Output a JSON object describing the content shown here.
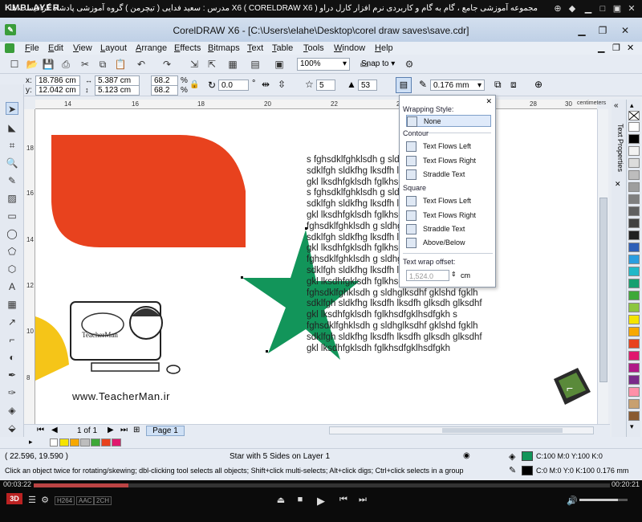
{
  "player": {
    "logo": "KMPLAYER",
    "title": "مجموعه آموزشی جامع ، گام به گام و کاربردی نرم افزار کارل دراو X6 ( CORELDRAW X6 ) مدرس : سعید فدایی ( تیچرمن ) گروه آموزشی پادشاه گرافیست ها",
    "time_elapsed": "00:03:22",
    "time_total": "00:20:21",
    "progress": 0.165,
    "codec_badges": [
      "H264",
      "AAC",
      "2CH"
    ]
  },
  "window": {
    "title": "CorelDRAW X6 - [C:\\Users\\elahe\\Desktop\\corel draw saves\\save.cdr]"
  },
  "menu": [
    "File",
    "Edit",
    "View",
    "Layout",
    "Arrange",
    "Effects",
    "Bitmaps",
    "Text",
    "Table",
    "Tools",
    "Window",
    "Help"
  ],
  "toolbar": {
    "zoom": "100%",
    "snap_to": "Snap to"
  },
  "property_bar": {
    "x": "18.786 cm",
    "y": "12.042 cm",
    "w": "5.387 cm",
    "h": "5.123 cm",
    "scale_w": "68.2",
    "scale_h": "68.2",
    "pct": "%",
    "angle": "0.0",
    "points": "5",
    "sharpness": "53",
    "outline_width": "0.176 mm"
  },
  "ruler": {
    "top_labels": [
      "14",
      "16",
      "18",
      "20",
      "22",
      "24",
      "26",
      "28",
      "30"
    ],
    "left_labels": [
      "18",
      "16",
      "14",
      "12",
      "10",
      "8"
    ],
    "unit": "centimeters"
  },
  "wrap_popup": {
    "wrapping_style": "Wrapping Style:",
    "none": "None",
    "contour_header": "Contour",
    "contour_left": "Text Flows Left",
    "contour_right": "Text Flows Right",
    "contour_straddle": "Straddle Text",
    "square_header": "Square",
    "square_left": "Text Flows Left",
    "square_right": "Text Flows Right",
    "square_straddle": "Straddle Text",
    "above_below": "Above/Below",
    "offset_label": "Text wrap offset:",
    "offset_value": "1,524.0",
    "offset_unit": "cm"
  },
  "docker": {
    "tab_label": "Text Properties"
  },
  "canvas_text": [
    "s fghsdklfghklsdh g sldhglksdhf gklshd fgklh",
    "sdklfgh sldkfhg lksdfh lksdfh glksdh glksdhf",
    "gkl lksdhfgklsdh fglkhsdfgklhsdfgkh s",
    "s fghsdklfghklsdh g sldhglksdhf gklshd fgklh",
    "sdklfgh sldkfhg lksdfh lksdfh glksdh glksdhf",
    "gkl lksdhfgklsdh fglkhsdfgklhsdfgkh s",
    "fghsdklfghklsdh g sldhglksdhf gklshd fgklh",
    "sdklfgh sldkfhg lksdfh lksdfh glksdh glksdhf",
    "gkl lksdhfgklsdh fglkhsdfgklhsdfgkh s",
    "fghsdklfghklsdh g sldhglksdhf gklshd fgklh",
    "sdklfgh sldkfhg lksdfh lksdfh glksdh glksdhf",
    "gkl lksdhfgklsdh fglkhsdfgklhsdfgkh s",
    "fghsdklfghklsdh g sldhglksdhf gklshd fgklh",
    "sdklfgh sldkfhg lksdfh lksdfh glksdh glksdhf",
    "gkl lksdhfgklsdh fglkhsdfgklhsdfgkh s",
    "fghsdklfghklsdh g sldhglksdhf gklshd fgklh",
    "sdklfgh sldkfhg lksdfh lksdfh glksdh glksdhf",
    "gkl lksdhfgklsdh fglkhsdfgklhsdfgkh"
  ],
  "watermark": {
    "brand": "TeacherMan",
    "url": "www.TeacherMan.ir"
  },
  "page_nav": {
    "counter": "1 of 1",
    "page_tab": "Page 1"
  },
  "status": {
    "coords": "( 22.596, 19.590 )",
    "object_info": "Star with 5 Sides on Layer 1",
    "hint": "Click an object twice for rotating/skewing; dbl-clicking tool selects all objects; Shift+click multi-selects; Alt+click digs; Ctrl+click selects in a group",
    "fill_info": "C:100 M:0 Y:100 K:0",
    "outline_info": "C:0 M:0 Y:0 K:100  0.176 mm"
  },
  "colors": {
    "red_shape": "#e8421e",
    "star": "#12955a",
    "yellow": "#f5c518"
  },
  "palette": [
    "#ffffff",
    "#000000",
    "#f2f2f2",
    "#dcdcdc",
    "#bdbdbd",
    "#9e9e9e",
    "#7f7f7f",
    "#606060",
    "#404040",
    "#202020",
    "#2e5fb8",
    "#2a9de0",
    "#20b8c8",
    "#15a070",
    "#3ea838",
    "#8cc63f",
    "#f5e400",
    "#f7a800",
    "#e8421e",
    "#e0186e",
    "#b01888",
    "#7a2a8a",
    "#ff8fa8",
    "#c8a070",
    "#8a5a30"
  ],
  "color_bar": [
    "#f5e400",
    "#f7a800",
    "#bdbdbd",
    "#3ea838",
    "#e8421e",
    "#e0186e"
  ]
}
